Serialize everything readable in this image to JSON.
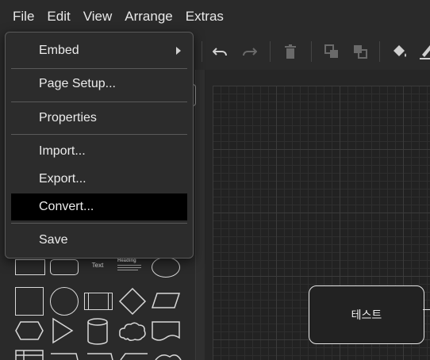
{
  "menubar": {
    "items": [
      "File",
      "Edit",
      "View",
      "Arrange",
      "Extras"
    ]
  },
  "file_menu": {
    "embed": "Embed",
    "page_setup": "Page Setup...",
    "properties": "Properties",
    "import": "Import...",
    "export": "Export...",
    "convert": "Convert...",
    "save": "Save"
  },
  "shapes_panel": {
    "text_label": "Text",
    "heading_label": "Heading"
  },
  "canvas": {
    "node_label": "테스트"
  },
  "icons": [
    "undo-icon",
    "redo-icon",
    "delete-icon",
    "to-front-icon",
    "to-back-icon",
    "fill-color-icon",
    "line-color-icon",
    "submenu-arrow-icon"
  ]
}
